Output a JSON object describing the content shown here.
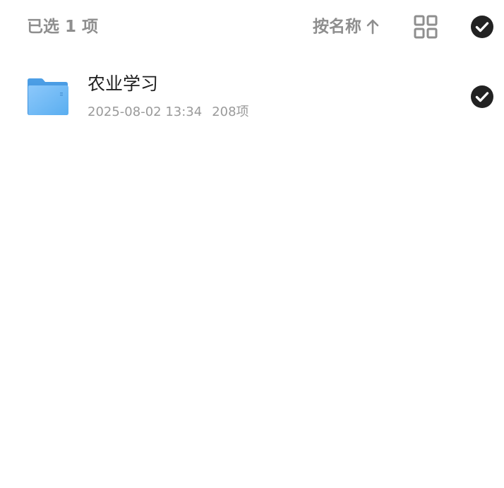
{
  "toolbar": {
    "selected_label": "已选 1 项",
    "sort_label": "按名称",
    "sort_direction_icon": "arrow-up-icon",
    "view_toggle_icon": "grid-view-icon",
    "select_all_icon": "check-circle-icon"
  },
  "files": [
    {
      "name": "农业学习",
      "type_icon": "folder-icon",
      "modified": "2025-08-02 13:34",
      "item_count": "208项",
      "selected": true
    }
  ],
  "colors": {
    "muted_text": "#8e8e8e",
    "primary_text": "#1f1f1f",
    "check_fill": "#222222",
    "folder_blue": "#5aaef0"
  }
}
